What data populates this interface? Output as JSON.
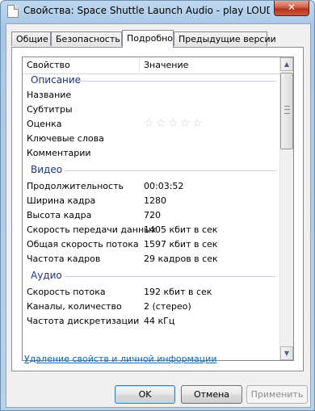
{
  "window": {
    "title": "Свойства: Space Shuttle Launch Audio - play LOUD (no ...",
    "close_glyph": "✕"
  },
  "tabs": [
    {
      "label": "Общие",
      "active": false
    },
    {
      "label": "Безопасность",
      "active": false
    },
    {
      "label": "Подробно",
      "active": true
    },
    {
      "label": "Предыдущие версии",
      "active": false
    }
  ],
  "list": {
    "headers": {
      "property": "Свойство",
      "value": "Значение"
    },
    "groups": {
      "description": {
        "label": "Описание",
        "rows": [
          {
            "key": "Название",
            "value": ""
          },
          {
            "key": "Субтитры",
            "value": ""
          },
          {
            "key": "Оценка",
            "rating": 0,
            "rating_max": 5,
            "star_glyph": "☆"
          },
          {
            "key": "Ключевые слова",
            "value": ""
          },
          {
            "key": "Комментарии",
            "value": ""
          }
        ]
      },
      "video": {
        "label": "Видео",
        "rows": [
          {
            "key": "Продолжительность",
            "value": "00:03:52"
          },
          {
            "key": "Ширина кадра",
            "value": "1280"
          },
          {
            "key": "Высота кадра",
            "value": "720"
          },
          {
            "key": "Скорость передачи данных",
            "value": "1405 кбит в сек"
          },
          {
            "key": "Общая скорость потока",
            "value": "1597 кбит в сек"
          },
          {
            "key": "Частота кадров",
            "value": "29 кадров в сек"
          }
        ]
      },
      "audio": {
        "label": "Аудио",
        "rows": [
          {
            "key": "Скорость потока",
            "value": "192 кбит в сек"
          },
          {
            "key": "Каналы, количество",
            "value": "2 (стерео)"
          },
          {
            "key": "Частота дискретизации",
            "value": "44 кГц"
          }
        ]
      }
    }
  },
  "link": {
    "label": "Удаление свойств и личной информации"
  },
  "buttons": {
    "ok": "OK",
    "cancel": "Отмена",
    "apply": "Применить"
  },
  "colors": {
    "group_header": "#1e3287",
    "link": "#0066cc",
    "title_bar": "#bfd8ee"
  }
}
